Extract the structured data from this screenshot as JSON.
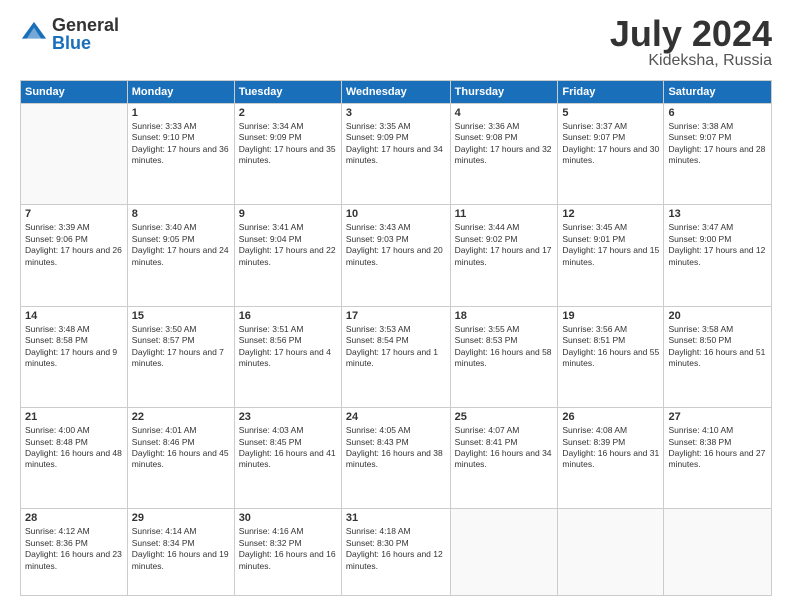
{
  "logo": {
    "general": "General",
    "blue": "Blue"
  },
  "header": {
    "month": "July 2024",
    "location": "Kideksha, Russia"
  },
  "days_header": [
    "Sunday",
    "Monday",
    "Tuesday",
    "Wednesday",
    "Thursday",
    "Friday",
    "Saturday"
  ],
  "weeks": [
    [
      {
        "num": "",
        "sunrise": "",
        "sunset": "",
        "daylight": ""
      },
      {
        "num": "1",
        "sunrise": "Sunrise: 3:33 AM",
        "sunset": "Sunset: 9:10 PM",
        "daylight": "Daylight: 17 hours and 36 minutes."
      },
      {
        "num": "2",
        "sunrise": "Sunrise: 3:34 AM",
        "sunset": "Sunset: 9:09 PM",
        "daylight": "Daylight: 17 hours and 35 minutes."
      },
      {
        "num": "3",
        "sunrise": "Sunrise: 3:35 AM",
        "sunset": "Sunset: 9:09 PM",
        "daylight": "Daylight: 17 hours and 34 minutes."
      },
      {
        "num": "4",
        "sunrise": "Sunrise: 3:36 AM",
        "sunset": "Sunset: 9:08 PM",
        "daylight": "Daylight: 17 hours and 32 minutes."
      },
      {
        "num": "5",
        "sunrise": "Sunrise: 3:37 AM",
        "sunset": "Sunset: 9:07 PM",
        "daylight": "Daylight: 17 hours and 30 minutes."
      },
      {
        "num": "6",
        "sunrise": "Sunrise: 3:38 AM",
        "sunset": "Sunset: 9:07 PM",
        "daylight": "Daylight: 17 hours and 28 minutes."
      }
    ],
    [
      {
        "num": "7",
        "sunrise": "Sunrise: 3:39 AM",
        "sunset": "Sunset: 9:06 PM",
        "daylight": "Daylight: 17 hours and 26 minutes."
      },
      {
        "num": "8",
        "sunrise": "Sunrise: 3:40 AM",
        "sunset": "Sunset: 9:05 PM",
        "daylight": "Daylight: 17 hours and 24 minutes."
      },
      {
        "num": "9",
        "sunrise": "Sunrise: 3:41 AM",
        "sunset": "Sunset: 9:04 PM",
        "daylight": "Daylight: 17 hours and 22 minutes."
      },
      {
        "num": "10",
        "sunrise": "Sunrise: 3:43 AM",
        "sunset": "Sunset: 9:03 PM",
        "daylight": "Daylight: 17 hours and 20 minutes."
      },
      {
        "num": "11",
        "sunrise": "Sunrise: 3:44 AM",
        "sunset": "Sunset: 9:02 PM",
        "daylight": "Daylight: 17 hours and 17 minutes."
      },
      {
        "num": "12",
        "sunrise": "Sunrise: 3:45 AM",
        "sunset": "Sunset: 9:01 PM",
        "daylight": "Daylight: 17 hours and 15 minutes."
      },
      {
        "num": "13",
        "sunrise": "Sunrise: 3:47 AM",
        "sunset": "Sunset: 9:00 PM",
        "daylight": "Daylight: 17 hours and 12 minutes."
      }
    ],
    [
      {
        "num": "14",
        "sunrise": "Sunrise: 3:48 AM",
        "sunset": "Sunset: 8:58 PM",
        "daylight": "Daylight: 17 hours and 9 minutes."
      },
      {
        "num": "15",
        "sunrise": "Sunrise: 3:50 AM",
        "sunset": "Sunset: 8:57 PM",
        "daylight": "Daylight: 17 hours and 7 minutes."
      },
      {
        "num": "16",
        "sunrise": "Sunrise: 3:51 AM",
        "sunset": "Sunset: 8:56 PM",
        "daylight": "Daylight: 17 hours and 4 minutes."
      },
      {
        "num": "17",
        "sunrise": "Sunrise: 3:53 AM",
        "sunset": "Sunset: 8:54 PM",
        "daylight": "Daylight: 17 hours and 1 minute."
      },
      {
        "num": "18",
        "sunrise": "Sunrise: 3:55 AM",
        "sunset": "Sunset: 8:53 PM",
        "daylight": "Daylight: 16 hours and 58 minutes."
      },
      {
        "num": "19",
        "sunrise": "Sunrise: 3:56 AM",
        "sunset": "Sunset: 8:51 PM",
        "daylight": "Daylight: 16 hours and 55 minutes."
      },
      {
        "num": "20",
        "sunrise": "Sunrise: 3:58 AM",
        "sunset": "Sunset: 8:50 PM",
        "daylight": "Daylight: 16 hours and 51 minutes."
      }
    ],
    [
      {
        "num": "21",
        "sunrise": "Sunrise: 4:00 AM",
        "sunset": "Sunset: 8:48 PM",
        "daylight": "Daylight: 16 hours and 48 minutes."
      },
      {
        "num": "22",
        "sunrise": "Sunrise: 4:01 AM",
        "sunset": "Sunset: 8:46 PM",
        "daylight": "Daylight: 16 hours and 45 minutes."
      },
      {
        "num": "23",
        "sunrise": "Sunrise: 4:03 AM",
        "sunset": "Sunset: 8:45 PM",
        "daylight": "Daylight: 16 hours and 41 minutes."
      },
      {
        "num": "24",
        "sunrise": "Sunrise: 4:05 AM",
        "sunset": "Sunset: 8:43 PM",
        "daylight": "Daylight: 16 hours and 38 minutes."
      },
      {
        "num": "25",
        "sunrise": "Sunrise: 4:07 AM",
        "sunset": "Sunset: 8:41 PM",
        "daylight": "Daylight: 16 hours and 34 minutes."
      },
      {
        "num": "26",
        "sunrise": "Sunrise: 4:08 AM",
        "sunset": "Sunset: 8:39 PM",
        "daylight": "Daylight: 16 hours and 31 minutes."
      },
      {
        "num": "27",
        "sunrise": "Sunrise: 4:10 AM",
        "sunset": "Sunset: 8:38 PM",
        "daylight": "Daylight: 16 hours and 27 minutes."
      }
    ],
    [
      {
        "num": "28",
        "sunrise": "Sunrise: 4:12 AM",
        "sunset": "Sunset: 8:36 PM",
        "daylight": "Daylight: 16 hours and 23 minutes."
      },
      {
        "num": "29",
        "sunrise": "Sunrise: 4:14 AM",
        "sunset": "Sunset: 8:34 PM",
        "daylight": "Daylight: 16 hours and 19 minutes."
      },
      {
        "num": "30",
        "sunrise": "Sunrise: 4:16 AM",
        "sunset": "Sunset: 8:32 PM",
        "daylight": "Daylight: 16 hours and 16 minutes."
      },
      {
        "num": "31",
        "sunrise": "Sunrise: 4:18 AM",
        "sunset": "Sunset: 8:30 PM",
        "daylight": "Daylight: 16 hours and 12 minutes."
      },
      {
        "num": "",
        "sunrise": "",
        "sunset": "",
        "daylight": ""
      },
      {
        "num": "",
        "sunrise": "",
        "sunset": "",
        "daylight": ""
      },
      {
        "num": "",
        "sunrise": "",
        "sunset": "",
        "daylight": ""
      }
    ]
  ]
}
